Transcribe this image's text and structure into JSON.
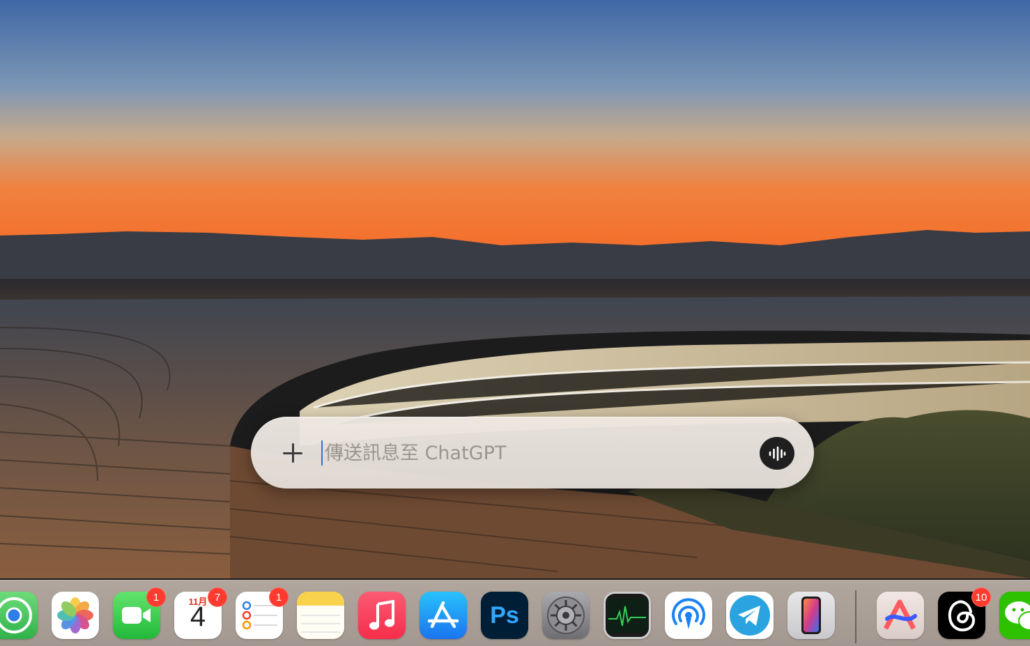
{
  "wallpaper": {
    "name": "sunset-campus-wallpaper"
  },
  "chatbar": {
    "placeholder": "傳送訊息至 ChatGPT",
    "add_icon": "plus-icon",
    "voice_icon": "voice-waveform-icon"
  },
  "dock": {
    "apps": [
      {
        "name": "find-my",
        "icon": "find-my-icon"
      },
      {
        "name": "photos",
        "icon": "photos-icon"
      },
      {
        "name": "facetime",
        "icon": "facetime-icon",
        "badge": "1"
      },
      {
        "name": "calendar",
        "icon": "calendar-icon",
        "month": "11月",
        "day": "4",
        "badge": "7"
      },
      {
        "name": "reminders",
        "icon": "reminders-icon",
        "badge": "1"
      },
      {
        "name": "notes",
        "icon": "notes-icon"
      },
      {
        "name": "music",
        "icon": "music-icon"
      },
      {
        "name": "app-store",
        "icon": "app-store-icon"
      },
      {
        "name": "photoshop",
        "icon": "photoshop-icon",
        "label": "Ps"
      },
      {
        "name": "system-settings",
        "icon": "gear-icon"
      },
      {
        "name": "activity-monitor",
        "icon": "activity-monitor-icon"
      },
      {
        "name": "airdrop",
        "icon": "airdrop-icon"
      },
      {
        "name": "telegram",
        "icon": "telegram-icon"
      },
      {
        "name": "iphone-mirroring",
        "icon": "iphone-icon"
      },
      {
        "name": "arc",
        "icon": "arc-icon"
      },
      {
        "name": "threads",
        "icon": "threads-icon",
        "badge": "10"
      },
      {
        "name": "wechat",
        "icon": "wechat-icon"
      }
    ]
  },
  "colors": {
    "badge": "#ff3b30",
    "chatbar_bg": "#ebe5df",
    "caret": "#2f6fe8",
    "voice_button": "#1f1f1f"
  }
}
